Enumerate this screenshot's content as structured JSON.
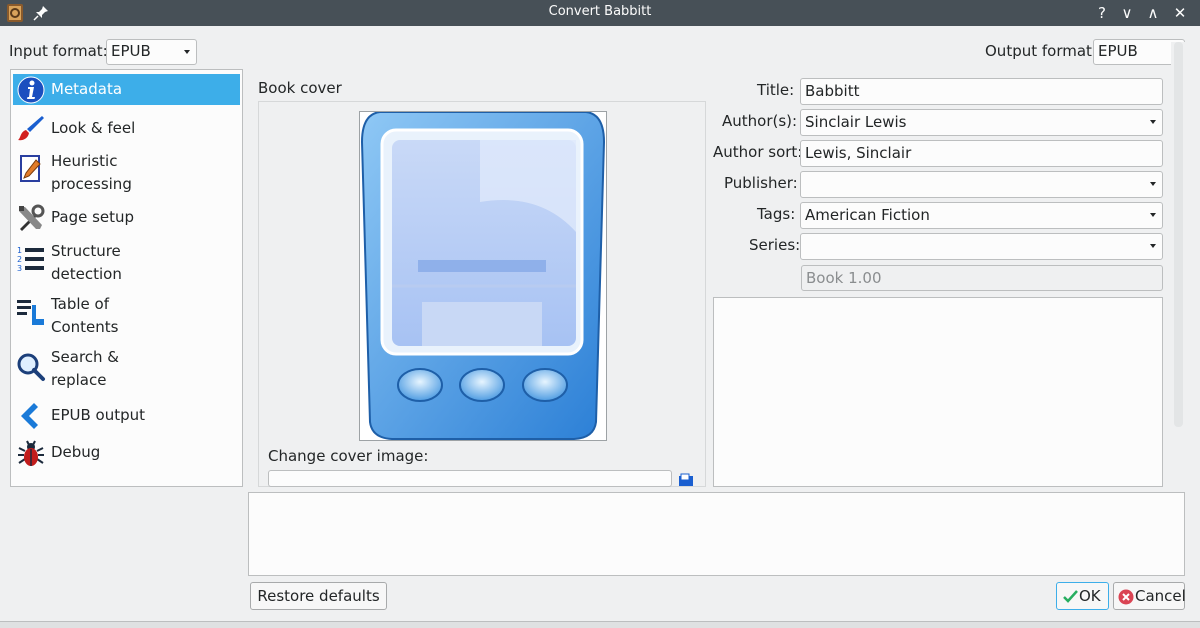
{
  "window": {
    "title": "Convert Babbitt",
    "controls": [
      "?",
      "∨",
      "∧",
      "✕"
    ]
  },
  "input_format": {
    "label": "Input format:",
    "value": "EPUB"
  },
  "output_format": {
    "label": "Output format:",
    "value": "EPUB"
  },
  "sidebar": {
    "items": [
      {
        "label": "Metadata",
        "icon": "info-icon",
        "selected": true
      },
      {
        "label": "Look & feel",
        "icon": "brush-icon"
      },
      {
        "label": "Heuristic\nprocessing",
        "icon": "pencil-document-icon"
      },
      {
        "label": "Page setup",
        "icon": "tools-icon"
      },
      {
        "label": "Structure\ndetection",
        "icon": "numbered-list-icon"
      },
      {
        "label": "Table of\nContents",
        "icon": "toc-icon"
      },
      {
        "label": "Search &\nreplace",
        "icon": "magnifier-icon"
      },
      {
        "label": "EPUB output",
        "icon": "chevron-left-icon"
      },
      {
        "label": "Debug",
        "icon": "bug-icon"
      }
    ]
  },
  "cover": {
    "heading": "Book cover",
    "change_label": "Change cover image:",
    "path_value": ""
  },
  "metadata": {
    "title_label": "Title:",
    "title_value": "Babbitt",
    "authors_label": "Author(s):",
    "authors_value": "Sinclair Lewis",
    "author_sort_label": "Author sort:",
    "author_sort_value": "Lewis, Sinclair",
    "publisher_label": "Publisher:",
    "publisher_value": "",
    "tags_label": "Tags:",
    "tags_value": "American Fiction",
    "series_label": "Series:",
    "series_value": "",
    "series_index": "Book 1.00"
  },
  "buttons": {
    "restore_defaults": "Restore defaults",
    "ok": "OK",
    "cancel": "Cancel"
  },
  "colors": {
    "selection": "#3daee9",
    "titlebar": "#475057"
  }
}
